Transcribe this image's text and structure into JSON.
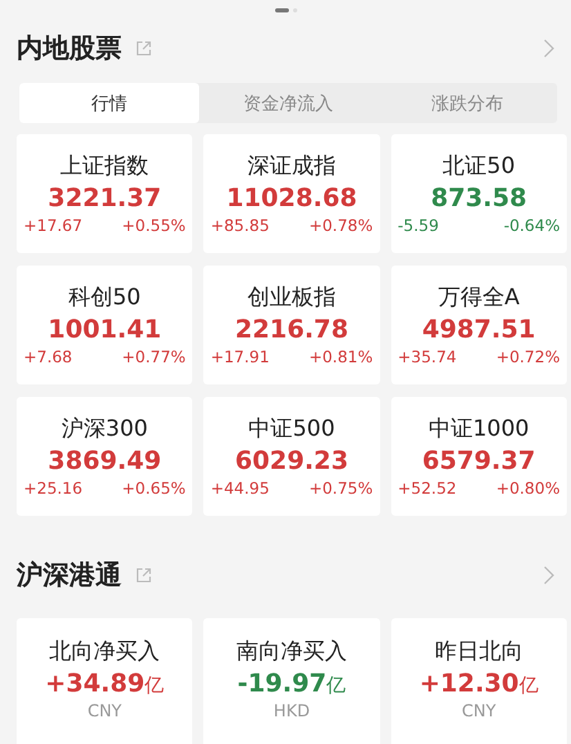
{
  "pager": [
    {
      "selected": true
    },
    {
      "selected": false
    }
  ],
  "sections": [
    {
      "title": "内地股票",
      "tabs": [
        {
          "label": "行情",
          "selected": true
        },
        {
          "label": "资金净流入",
          "selected": false
        },
        {
          "label": "涨跌分布",
          "selected": false
        }
      ],
      "indices": [
        {
          "name": "上证指数",
          "value": "3221.37",
          "change": "+17.67",
          "percent": "+0.55%",
          "color": "#d23b3b"
        },
        {
          "name": "深证成指",
          "value": "11028.68",
          "change": "+85.85",
          "percent": "+0.78%",
          "color": "#d23b3b"
        },
        {
          "name": "北证50",
          "value": "873.58",
          "change": "-5.59",
          "percent": "-0.64%",
          "color": "#2f8a4c"
        },
        {
          "name": "科创50",
          "value": "1001.41",
          "change": "+7.68",
          "percent": "+0.77%",
          "color": "#d23b3b"
        },
        {
          "name": "创业板指",
          "value": "2216.78",
          "change": "+17.91",
          "percent": "+0.81%",
          "color": "#d23b3b"
        },
        {
          "name": "万得全A",
          "value": "4987.51",
          "change": "+35.74",
          "percent": "+0.72%",
          "color": "#d23b3b"
        },
        {
          "name": "沪深300",
          "value": "3869.49",
          "change": "+25.16",
          "percent": "+0.65%",
          "color": "#d23b3b"
        },
        {
          "name": "中证500",
          "value": "6029.23",
          "change": "+44.95",
          "percent": "+0.75%",
          "color": "#d23b3b"
        },
        {
          "name": "中证1000",
          "value": "6579.37",
          "change": "+52.52",
          "percent": "+0.80%",
          "color": "#d23b3b"
        }
      ]
    },
    {
      "title": "沪深港通",
      "flows": [
        {
          "name": "北向净买入",
          "value": "+34.89",
          "unit": "亿",
          "currency": "CNY",
          "color": "#d23b3b"
        },
        {
          "name": "南向净买入",
          "value": "-19.97",
          "unit": "亿",
          "currency": "HKD",
          "color": "#2f8a4c"
        },
        {
          "name": "昨日北向",
          "value": "+12.30",
          "unit": "亿",
          "currency": "CNY",
          "color": "#d23b3b"
        }
      ]
    }
  ]
}
